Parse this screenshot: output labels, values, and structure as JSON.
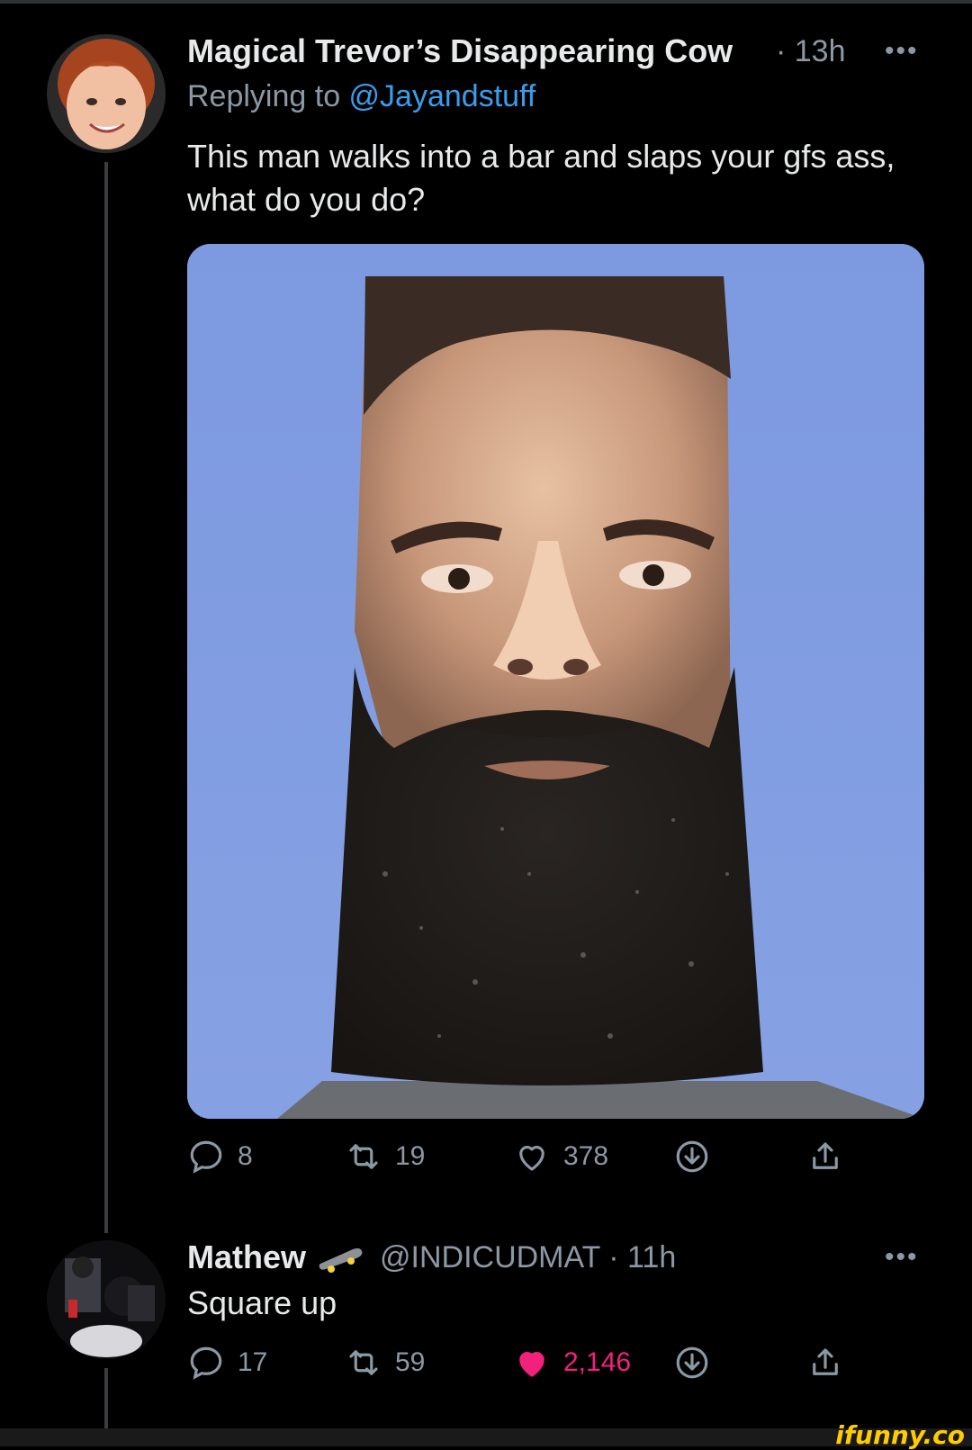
{
  "tweets": [
    {
      "author_name": "Magical Trevor’s Disappearing Cow",
      "time": "· 13h",
      "more": "•••",
      "replying_prefix": "Replying to ",
      "replying_handle": "@Jayandstuff",
      "text": "This man walks into a bar and slaps your gfs ass, what do you do?",
      "has_media": true,
      "actions": {
        "replies": "8",
        "retweets": "19",
        "likes": "378"
      }
    },
    {
      "author_name": "Mathew",
      "handle_time": "@INDICUDMAT · 11h",
      "more": "•••",
      "text": "Square up",
      "actions": {
        "replies": "17",
        "retweets": "59",
        "likes": "2,146",
        "liked": true
      }
    }
  ],
  "watermark": "ifunny.co",
  "icons": [
    "reply-icon",
    "retweet-icon",
    "like-icon",
    "download-icon",
    "share-icon",
    "skateboard-icon",
    "more-icon"
  ],
  "colors": {
    "background": "#000000",
    "link": "#3b9ceb",
    "muted": "#8b98a5",
    "liked": "#f4217c",
    "watermark": "#ffcc00"
  }
}
